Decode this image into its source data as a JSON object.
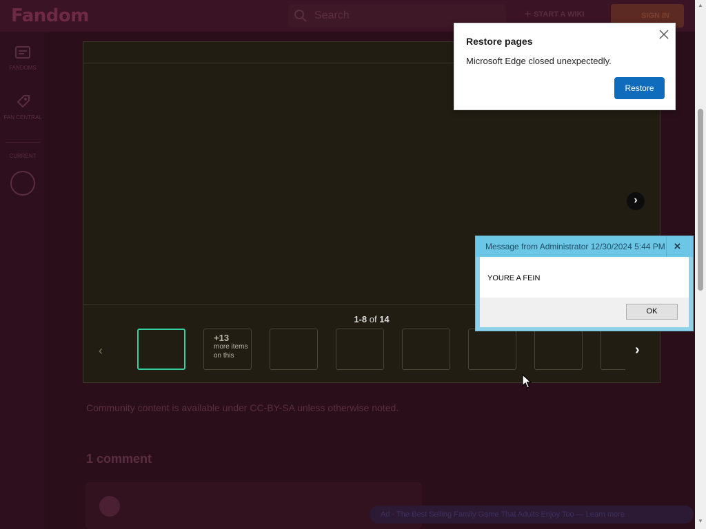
{
  "page": {
    "logo": "Fandom",
    "search_placeholder": "Search",
    "start_wiki": "START A WIKI",
    "sign_in": "SIGN IN",
    "sidebar": {
      "item1": "FANDOMS",
      "item2": "FAN CENTRAL",
      "section": "CURRENT"
    },
    "license_text": "Community content is available under CC-BY-SA unless otherwise noted.",
    "comments_title": "1 comment",
    "bottom_banner": "Ad · The Best Selling Family Game That Adults Enjoy Too — Learn more"
  },
  "lightbox": {
    "counter_range": "1-8",
    "counter_of": "of",
    "counter_total": "14",
    "more_count": "+13",
    "more_label": "more items on this"
  },
  "restore_popup": {
    "title": "Restore pages",
    "message": "Microsoft Edge closed unexpectedly.",
    "button": "Restore"
  },
  "message_box": {
    "title": "Message from Administrator 12/30/2024 5:44 PM",
    "text": "YOURE A FEIN",
    "ok_label": "OK"
  },
  "colors": {
    "edge_blue": "#0f6cbd",
    "thumb_active": "#35d0a0",
    "msgbox_titlebar": "#6cc7e6"
  }
}
